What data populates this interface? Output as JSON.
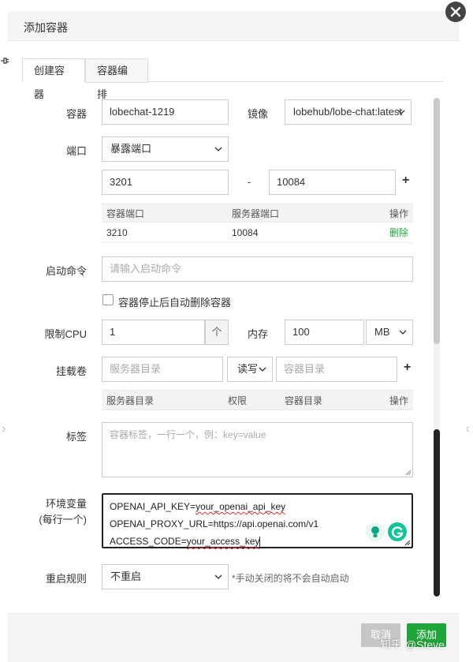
{
  "dialog": {
    "title": "添加容器"
  },
  "tabs": [
    {
      "label": "创建容器",
      "active": true
    },
    {
      "label": "容器编排",
      "active": false
    }
  ],
  "form": {
    "container": {
      "label": "容器",
      "value": "lobechat-1219"
    },
    "image": {
      "label": "镜像",
      "value": "lobehub/lobe-chat:latest"
    },
    "port": {
      "label": "端口",
      "mode": "暴露端口",
      "container_port": "3201",
      "separator": "-",
      "server_port": "10084",
      "add_symbol": "+",
      "table": {
        "headers": [
          "容器端口",
          "服务器端口",
          "操作"
        ],
        "rows": [
          {
            "container_port": "3210",
            "server_port": "10084",
            "action": "删除"
          }
        ]
      }
    },
    "command": {
      "label": "启动命令",
      "placeholder": "请输入启动命令"
    },
    "auto_remove": {
      "label": "容器停止后自动删除容器",
      "checked": false
    },
    "cpu": {
      "label": "限制CPU",
      "value": "1",
      "stepper": "个"
    },
    "memory": {
      "label": "内存",
      "value": "100",
      "unit": "MB"
    },
    "volume": {
      "label": "挂载卷",
      "server_placeholder": "服务器目录",
      "permission": "读写",
      "container_placeholder": "容器目录",
      "add_symbol": "+",
      "table": {
        "headers": [
          "服务器目录",
          "权限",
          "容器目录",
          "操作"
        ]
      }
    },
    "tags": {
      "label": "标签",
      "placeholder": "容器标签，一行一个，例：key=value"
    },
    "env": {
      "label_line1": "环境变量",
      "label_line2": "(每行一个)",
      "lines": [
        {
          "prefix": "OPENAI_API_KEY=",
          "marked": "your_openai_api_key"
        },
        {
          "prefix": "OPENAI_PROXY_URL=https://api.openai.com/v1",
          "marked": ""
        },
        {
          "prefix": "ACCESS_CODE=",
          "marked": "your_access_key"
        }
      ]
    },
    "restart": {
      "label": "重启规则",
      "value": "不重启",
      "hint": "*手动关闭的将不会自动启动"
    }
  },
  "footer": {
    "cancel_label": "取消",
    "add_label": "添加"
  },
  "watermark": "知乎 @Steve",
  "colors": {
    "accent": "#20a53a",
    "close_bg": "#444444",
    "delete_link": "#20a53a"
  }
}
